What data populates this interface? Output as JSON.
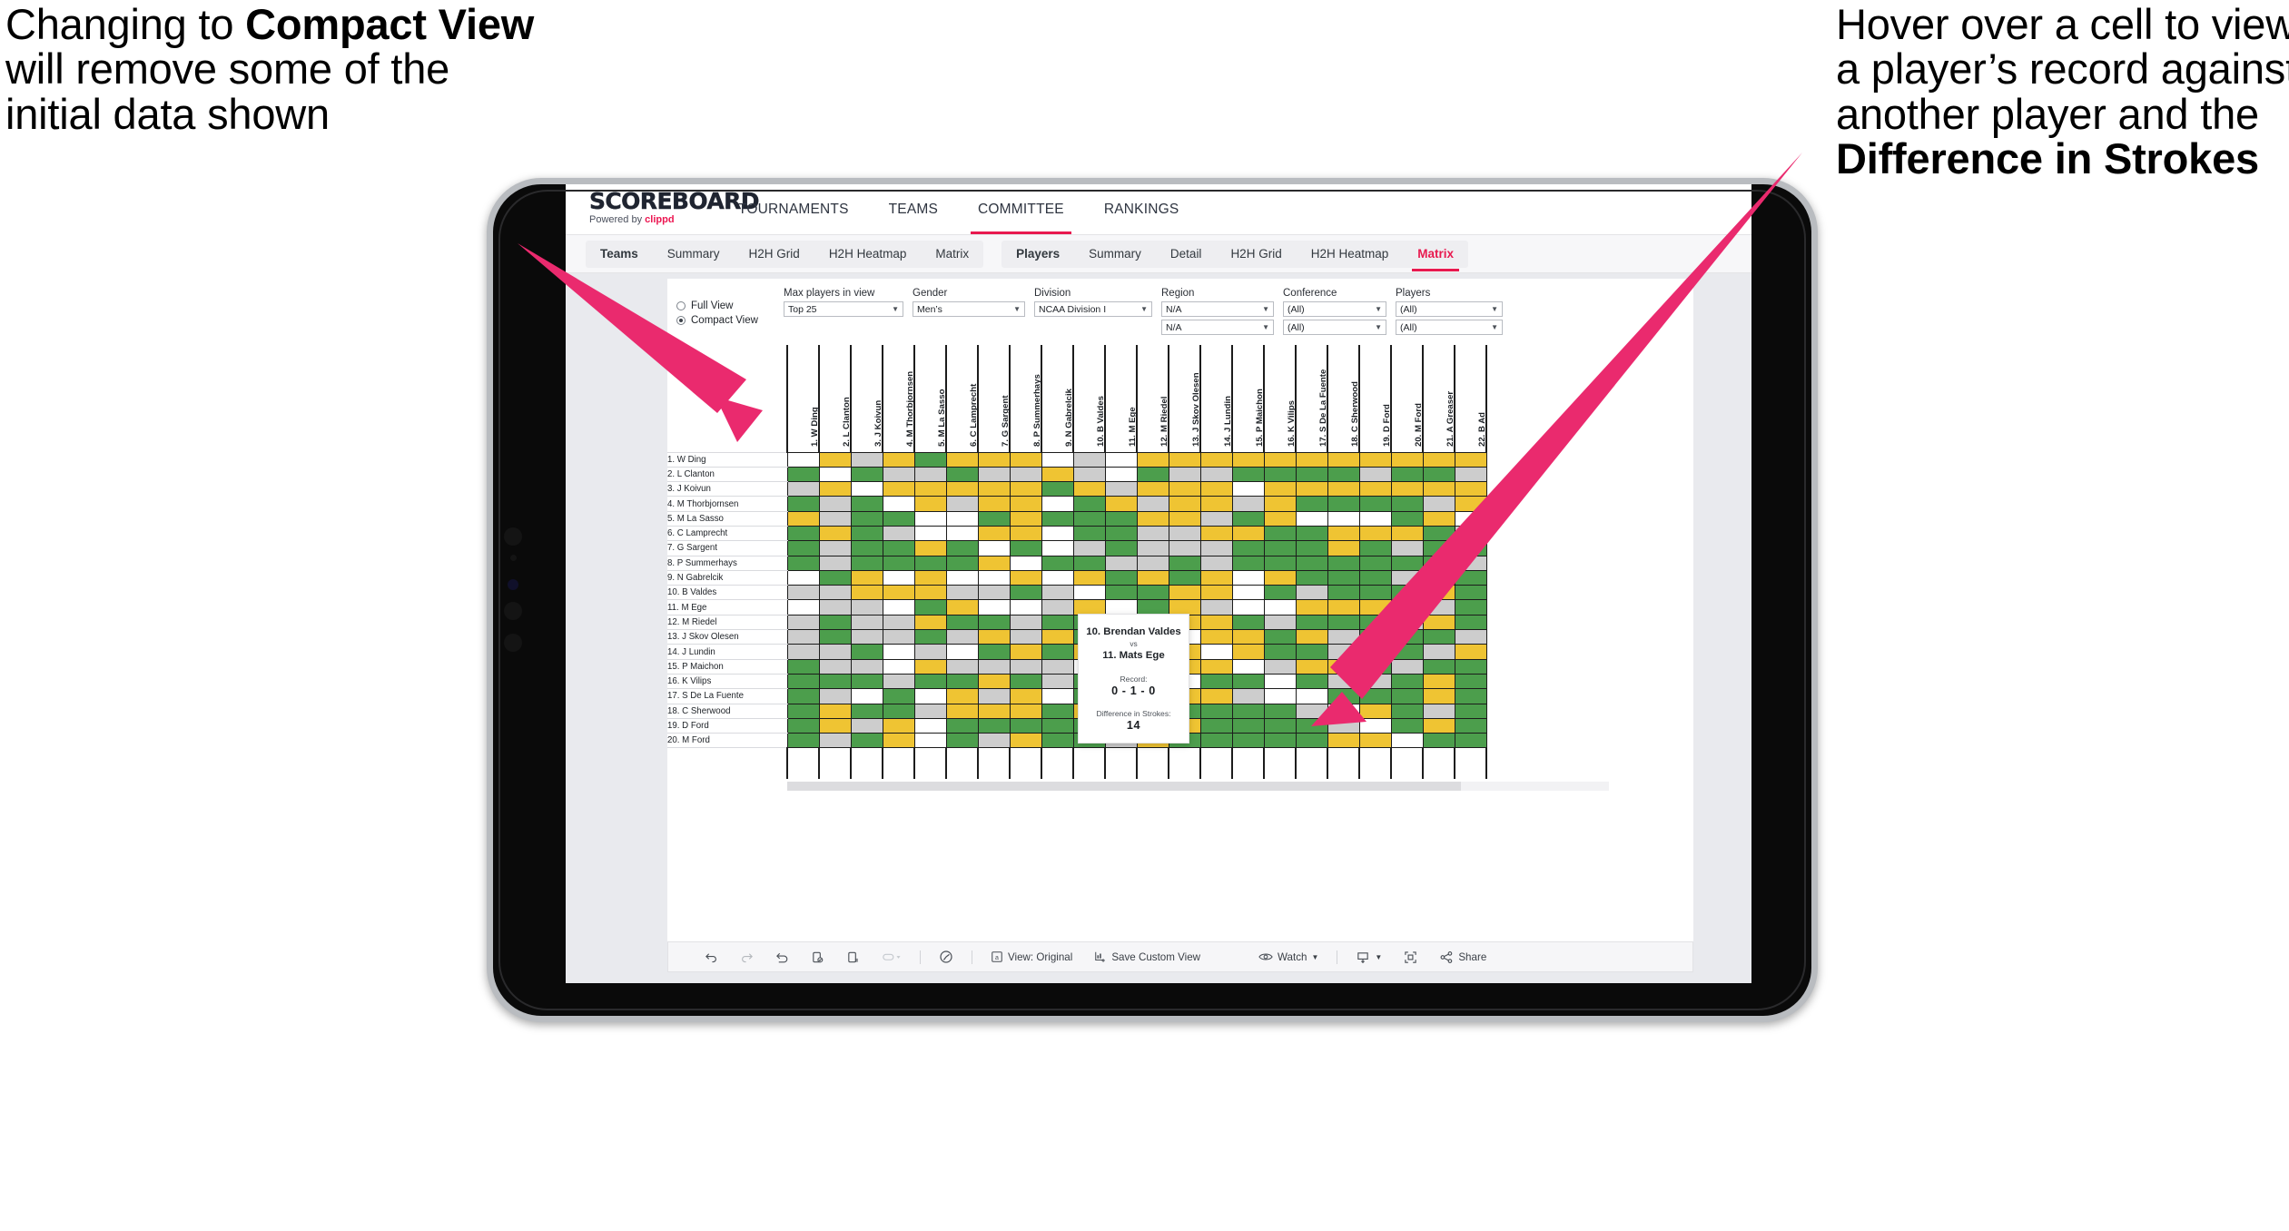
{
  "annotations": {
    "left": {
      "pre": "Changing to ",
      "bold": "Compact View",
      "post": " will remove some of the initial data shown"
    },
    "right": {
      "pre": "Hover over a cell to view a player’s record against another player and the ",
      "bold": "Difference in Strokes",
      "post": ""
    }
  },
  "brand": {
    "word": "SCOREBOARD",
    "powered_by": "Powered by ",
    "clippd": "clippd"
  },
  "topnav": [
    {
      "label": "TOURNAMENTS",
      "active": false
    },
    {
      "label": "TEAMS",
      "active": false
    },
    {
      "label": "COMMITTEE",
      "active": true
    },
    {
      "label": "RANKINGS",
      "active": false
    }
  ],
  "subnav": {
    "group1": [
      {
        "label": "Teams",
        "style": "bold"
      },
      {
        "label": "Summary",
        "style": ""
      },
      {
        "label": "H2H Grid",
        "style": ""
      },
      {
        "label": "H2H Heatmap",
        "style": ""
      },
      {
        "label": "Matrix",
        "style": ""
      }
    ],
    "group2": [
      {
        "label": "Players",
        "style": "bold"
      },
      {
        "label": "Summary",
        "style": ""
      },
      {
        "label": "Detail",
        "style": ""
      },
      {
        "label": "H2H Grid",
        "style": ""
      },
      {
        "label": "H2H Heatmap",
        "style": ""
      },
      {
        "label": "Matrix",
        "style": "pink"
      }
    ]
  },
  "view_mode": {
    "options": [
      {
        "label": "Full View",
        "selected": false
      },
      {
        "label": "Compact View",
        "selected": true
      }
    ]
  },
  "filters": [
    {
      "label": "Max players in view",
      "values": [
        "Top 25"
      ]
    },
    {
      "label": "Gender",
      "values": [
        "Men’s"
      ]
    },
    {
      "label": "Division",
      "values": [
        "NCAA Division I"
      ]
    },
    {
      "label": "Region",
      "values": [
        "N/A",
        "N/A"
      ]
    },
    {
      "label": "Conference",
      "values": [
        "(All)",
        "(All)"
      ]
    },
    {
      "label": "Players",
      "values": [
        "(All)",
        "(All)"
      ]
    }
  ],
  "matrix": {
    "columns": [
      "1. W Ding",
      "2. L Clanton",
      "3. J Koivun",
      "4. M Thorbjornsen",
      "5. M La Sasso",
      "6. C Lamprecht",
      "7. G Sargent",
      "8. P Summerhays",
      "9. N Gabrelcik",
      "10. B Valdes",
      "11. M Ege",
      "12. M Riedel",
      "13. J Skov Olesen",
      "14. J Lundin",
      "15. P Maichon",
      "16. K Vilips",
      "17. S De La Fuente",
      "18. C Sherwood",
      "19. D Ford",
      "20. M Ford",
      "21. A Greaser",
      "22. B Ad"
    ],
    "rows": [
      "1. W Ding",
      "2. L Clanton",
      "3. J Koivun",
      "4. M Thorbjornsen",
      "5. M La Sasso",
      "6. C Lamprecht",
      "7. G Sargent",
      "8. P Summerhays",
      "9. N Gabrelcik",
      "10. B Valdes",
      "11. M Ege",
      "12. M Riedel",
      "13. J Skov Olesen",
      "14. J Lundin",
      "15. P Maichon",
      "16. K Vilips",
      "17. S De La Fuente",
      "18. C Sherwood",
      "19. D Ford",
      "20. M Ford"
    ],
    "legend": {
      "win": "#4c9e4c",
      "loss": "#efc433",
      "tie_or_none": "#cdcdcd",
      "self_or_empty": "#ffffff"
    },
    "cells": [
      [
        "w",
        "y",
        "e",
        "y",
        "g",
        "y",
        "y",
        "y",
        "w",
        "e",
        "w",
        "y",
        "y",
        "y",
        "y",
        "y",
        "y",
        "y",
        "y",
        "y",
        "y",
        "y"
      ],
      [
        "g",
        "w",
        "g",
        "e",
        "e",
        "g",
        "e",
        "e",
        "y",
        "e",
        "w",
        "g",
        "e",
        "e",
        "g",
        "g",
        "g",
        "g",
        "e",
        "g",
        "g",
        "e"
      ],
      [
        "e",
        "y",
        "w",
        "y",
        "y",
        "y",
        "y",
        "y",
        "g",
        "y",
        "e",
        "y",
        "y",
        "y",
        "w",
        "y",
        "y",
        "y",
        "y",
        "y",
        "y",
        "y"
      ],
      [
        "g",
        "e",
        "g",
        "w",
        "y",
        "e",
        "y",
        "y",
        "w",
        "g",
        "y",
        "e",
        "y",
        "y",
        "e",
        "y",
        "g",
        "g",
        "g",
        "g",
        "e",
        "y"
      ],
      [
        "y",
        "e",
        "g",
        "g",
        "w",
        "w",
        "g",
        "y",
        "g",
        "g",
        "g",
        "y",
        "y",
        "e",
        "g",
        "y",
        "w",
        "w",
        "w",
        "g",
        "y",
        "w"
      ],
      [
        "g",
        "y",
        "g",
        "e",
        "w",
        "w",
        "y",
        "y",
        "w",
        "g",
        "g",
        "e",
        "e",
        "y",
        "y",
        "g",
        "g",
        "y",
        "y",
        "y",
        "g",
        "e"
      ],
      [
        "g",
        "e",
        "g",
        "g",
        "y",
        "g",
        "w",
        "g",
        "w",
        "e",
        "g",
        "e",
        "e",
        "e",
        "g",
        "g",
        "g",
        "y",
        "g",
        "e",
        "g",
        "g"
      ],
      [
        "g",
        "e",
        "g",
        "g",
        "g",
        "g",
        "y",
        "w",
        "g",
        "g",
        "e",
        "e",
        "g",
        "e",
        "g",
        "g",
        "g",
        "g",
        "g",
        "g",
        "g",
        "e"
      ],
      [
        "w",
        "g",
        "y",
        "w",
        "y",
        "w",
        "w",
        "y",
        "w",
        "y",
        "g",
        "y",
        "g",
        "y",
        "w",
        "y",
        "g",
        "g",
        "g",
        "e",
        "y",
        "g"
      ],
      [
        "e",
        "e",
        "y",
        "y",
        "y",
        "e",
        "e",
        "g",
        "e",
        "w",
        "g",
        "g",
        "y",
        "y",
        "w",
        "g",
        "e",
        "g",
        "g",
        "g",
        "y",
        "g"
      ],
      [
        "w",
        "e",
        "e",
        "w",
        "g",
        "y",
        "w",
        "w",
        "e",
        "y",
        "w",
        "g",
        "y",
        "e",
        "w",
        "w",
        "y",
        "y",
        "y",
        "g",
        "e",
        "g"
      ],
      [
        "e",
        "g",
        "e",
        "e",
        "y",
        "g",
        "g",
        "e",
        "g",
        "g",
        "e",
        "w",
        "y",
        "y",
        "g",
        "e",
        "g",
        "g",
        "g",
        "e",
        "y",
        "g"
      ],
      [
        "e",
        "g",
        "e",
        "e",
        "g",
        "e",
        "y",
        "e",
        "y",
        "g",
        "g",
        "y",
        "w",
        "y",
        "y",
        "g",
        "y",
        "e",
        "g",
        "g",
        "g",
        "e"
      ],
      [
        "e",
        "e",
        "g",
        "w",
        "e",
        "w",
        "g",
        "y",
        "g",
        "y",
        "g",
        "y",
        "y",
        "w",
        "y",
        "g",
        "g",
        "e",
        "e",
        "g",
        "e",
        "y"
      ],
      [
        "g",
        "e",
        "e",
        "w",
        "y",
        "e",
        "e",
        "e",
        "e",
        "w",
        "g",
        "g",
        "y",
        "y",
        "w",
        "e",
        "y",
        "y",
        "g",
        "e",
        "g",
        "g"
      ],
      [
        "g",
        "g",
        "g",
        "e",
        "g",
        "g",
        "y",
        "g",
        "e",
        "g",
        "g",
        "e",
        "w",
        "g",
        "g",
        "w",
        "g",
        "e",
        "e",
        "g",
        "y",
        "g"
      ],
      [
        "g",
        "e",
        "w",
        "g",
        "w",
        "y",
        "e",
        "y",
        "w",
        "g",
        "y",
        "g",
        "y",
        "y",
        "e",
        "w",
        "w",
        "g",
        "g",
        "g",
        "y",
        "g"
      ],
      [
        "g",
        "y",
        "g",
        "g",
        "e",
        "y",
        "y",
        "y",
        "g",
        "y",
        "g",
        "g",
        "g",
        "g",
        "g",
        "g",
        "e",
        "w",
        "y",
        "g",
        "e",
        "g"
      ],
      [
        "g",
        "y",
        "e",
        "y",
        "w",
        "g",
        "g",
        "g",
        "g",
        "g",
        "e",
        "g",
        "y",
        "g",
        "g",
        "g",
        "g",
        "e",
        "w",
        "g",
        "y",
        "g"
      ],
      [
        "g",
        "e",
        "g",
        "y",
        "w",
        "g",
        "e",
        "y",
        "g",
        "g",
        "e",
        "y",
        "g",
        "g",
        "g",
        "g",
        "g",
        "y",
        "y",
        "w",
        "g",
        "g"
      ]
    ]
  },
  "tooltip": {
    "player_a": "10. Brendan Valdes",
    "vs": "vs",
    "player_b": "11. Mats Ege",
    "record_label": "Record:",
    "record_value": "0 - 1 - 0",
    "diff_label": "Difference in Strokes:",
    "diff_value": "14"
  },
  "toolbar": {
    "items": [
      {
        "name": "undo",
        "icon": "undo-icon",
        "label": ""
      },
      {
        "name": "redo",
        "icon": "redo-icon",
        "label": ""
      },
      {
        "name": "revert",
        "icon": "revert-icon",
        "label": ""
      },
      {
        "name": "refresh",
        "icon": "refresh-data-icon",
        "label": ""
      },
      {
        "name": "pause",
        "icon": "pause-updates-icon",
        "label": ""
      },
      {
        "name": "highlight",
        "icon": "highlight-icon",
        "label": ""
      },
      {
        "name": "sep1",
        "icon": "separator",
        "label": ""
      },
      {
        "name": "clock",
        "icon": "history-icon",
        "label": ""
      },
      {
        "name": "sep2",
        "icon": "separator",
        "label": ""
      },
      {
        "name": "view",
        "icon": "view-icon",
        "label": "View: Original"
      },
      {
        "name": "save-custom-view",
        "icon": "save-view-icon",
        "label": "Save Custom View"
      },
      {
        "name": "watch",
        "icon": "eye-icon",
        "label": "Watch"
      },
      {
        "name": "sep3",
        "icon": "separator",
        "label": ""
      },
      {
        "name": "download",
        "icon": "download-icon",
        "label": ""
      },
      {
        "name": "fullscreen",
        "icon": "fullscreen-icon",
        "label": ""
      },
      {
        "name": "share",
        "icon": "share-icon",
        "label": "Share"
      }
    ]
  },
  "colors": {
    "accent_pink": "#e8194f",
    "green": "#4c9e4c",
    "yellow": "#efc433",
    "grey": "#cdcdcd"
  }
}
